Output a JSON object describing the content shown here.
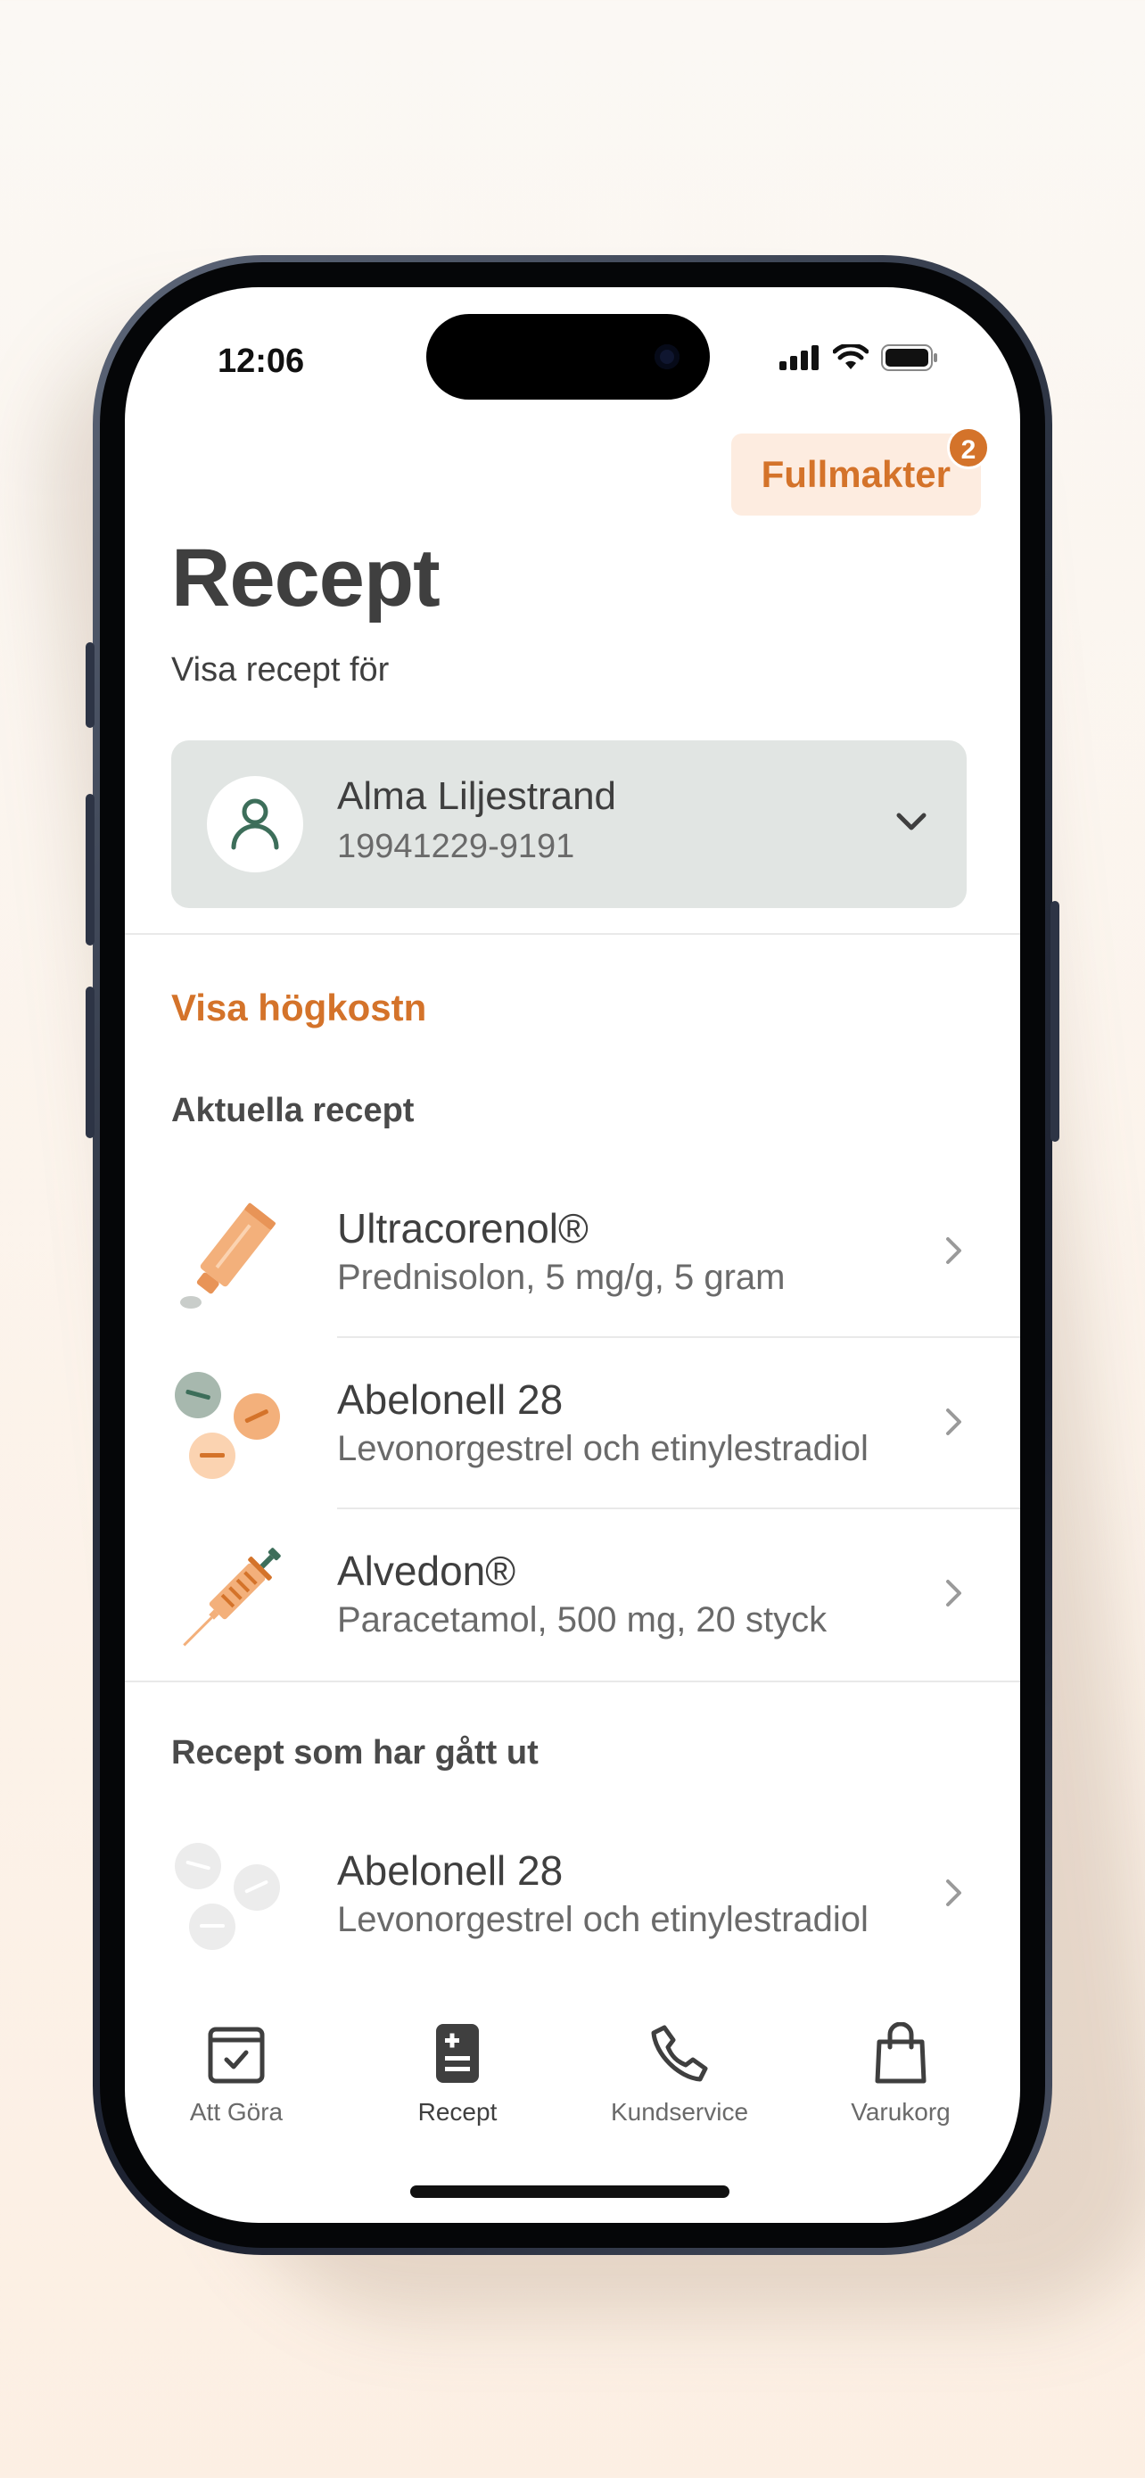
{
  "status": {
    "time": "12:06"
  },
  "header": {
    "fullmakter_label": "Fullmakter",
    "fullmakter_count": "2",
    "title": "Recept",
    "subtitle": "Visa recept för"
  },
  "person": {
    "name": "Alma Liljestrand",
    "id": "19941229-9191"
  },
  "link_hogkostnad": "Visa högkostn",
  "sections": {
    "current_label": "Aktuella recept",
    "expired_label": "Recept som har gått ut"
  },
  "current": [
    {
      "name": "Ultracorenol®",
      "desc": "Prednisolon, 5 mg/g, 5 gram",
      "icon": "cream-tube-icon"
    },
    {
      "name": "Abelonell 28",
      "desc": "Levonorgestrel och etinylestradiol",
      "icon": "pills-icon"
    },
    {
      "name": "Alvedon®",
      "desc": "Paracetamol, 500 mg, 20 styck",
      "icon": "syringe-icon"
    }
  ],
  "expired": [
    {
      "name": "Abelonell 28",
      "desc": "Levonorgestrel och etinylestradiol",
      "icon": "pills-grey-icon"
    }
  ],
  "tabs": [
    {
      "label": "Att Göra",
      "icon": "checklist-icon"
    },
    {
      "label": "Recept",
      "icon": "prescription-icon",
      "active": true
    },
    {
      "label": "Kundservice",
      "icon": "phone-icon"
    },
    {
      "label": "Varukorg",
      "icon": "shopping-bag-icon"
    }
  ],
  "colors": {
    "accent": "#d4732a",
    "card": "#e1e5e3",
    "text": "#3f3f3f"
  }
}
